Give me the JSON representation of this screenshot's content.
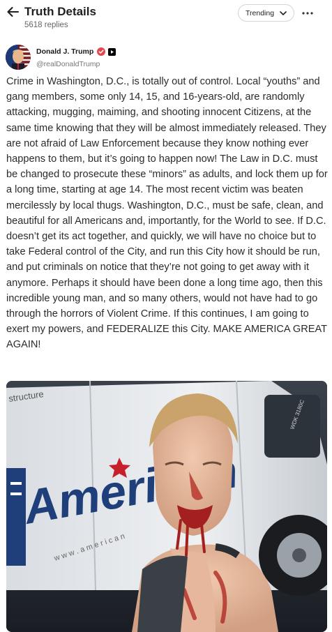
{
  "header": {
    "title": "Truth Details",
    "subtitle": "5618 replies",
    "sort_label": "Trending"
  },
  "post": {
    "author_name": "Donald J. Trump",
    "handle": "@realDonaldTrump",
    "text": "Crime in Washington, D.C., is totally out of control. Local “youths” and gang members, some only 14, 15, and 16-years-old, are randomly attacking, mugging, maiming, and shooting innocent Citizens, at the same time knowing that they will be almost immediately released. They are not afraid of Law Enforcement because they know nothing ever happens to them, but it’s going to happen now! The Law in D.C. must be changed to prosecute these “minors” as adults, and lock them up for a long time, starting at age 14. The most recent victim was beaten mercilessly by local thugs. Washington, D.C., must be safe, clean, and beautiful for all Americans and, importantly, for the World to see. If D.C. doesn’t get its act together, and quickly, we will have no choice but to take Federal control of the City, and run this City how it should be run, and put criminals on notice that they’re not going to get away with it anymore. Perhaps it should have been done a long time ago, then this incredible young man, and so many others, would not have had to go through the horrors of Violent Crime. If this continues, I am going to exert my powers, and FEDERALIZE this City. MAKE AMERICA GREAT AGAIN!"
  },
  "media": {
    "van_brand": "American",
    "van_tagline": "structure",
    "van_url": "w w w . a m e r i c a n",
    "van_plate": "WDK 3180C"
  },
  "colors": {
    "verified": "#e5484d",
    "avatar_bg": "#7b1a1a",
    "van_blue": "#1f3f7a",
    "van_red": "#c8202b"
  }
}
